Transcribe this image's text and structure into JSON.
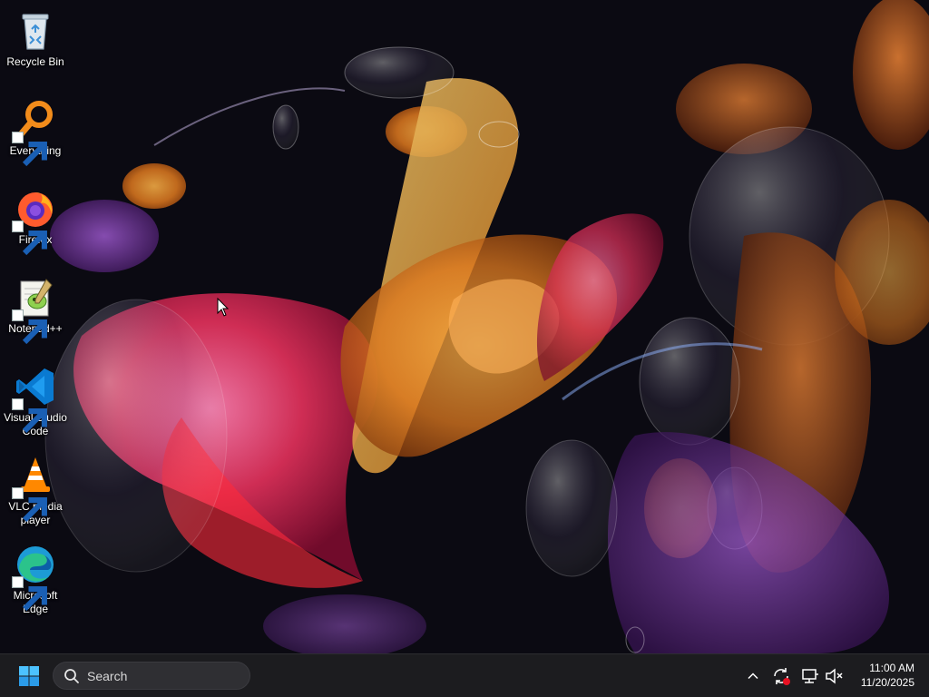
{
  "desktop": {
    "icons": [
      {
        "label": "Recycle Bin",
        "icon": "recycle-bin-icon"
      },
      {
        "label": "Everything",
        "icon": "everything-search-icon"
      },
      {
        "label": "Firefox",
        "icon": "firefox-icon"
      },
      {
        "label": "Notepad++",
        "icon": "notepad-plus-plus-icon"
      },
      {
        "label": "Visual Studio Code",
        "icon": "vscode-icon"
      },
      {
        "label": "VLC media player",
        "icon": "vlc-icon"
      },
      {
        "label": "Microsoft Edge",
        "icon": "edge-icon"
      }
    ]
  },
  "taskbar": {
    "start_icon": "windows-logo-icon",
    "search": {
      "placeholder": "Search",
      "icon": "search-icon"
    },
    "tray": {
      "icons": [
        "chevron-up-icon",
        "sync-icon",
        "network-icon",
        "speaker-muted-icon"
      ]
    },
    "clock": {
      "time": "11:00 AM",
      "date": "11/20/2025"
    }
  },
  "colors": {
    "taskbar_bg": "#1c1c1f",
    "search_bg": "#2f2f33",
    "accent": "#0078d4"
  }
}
